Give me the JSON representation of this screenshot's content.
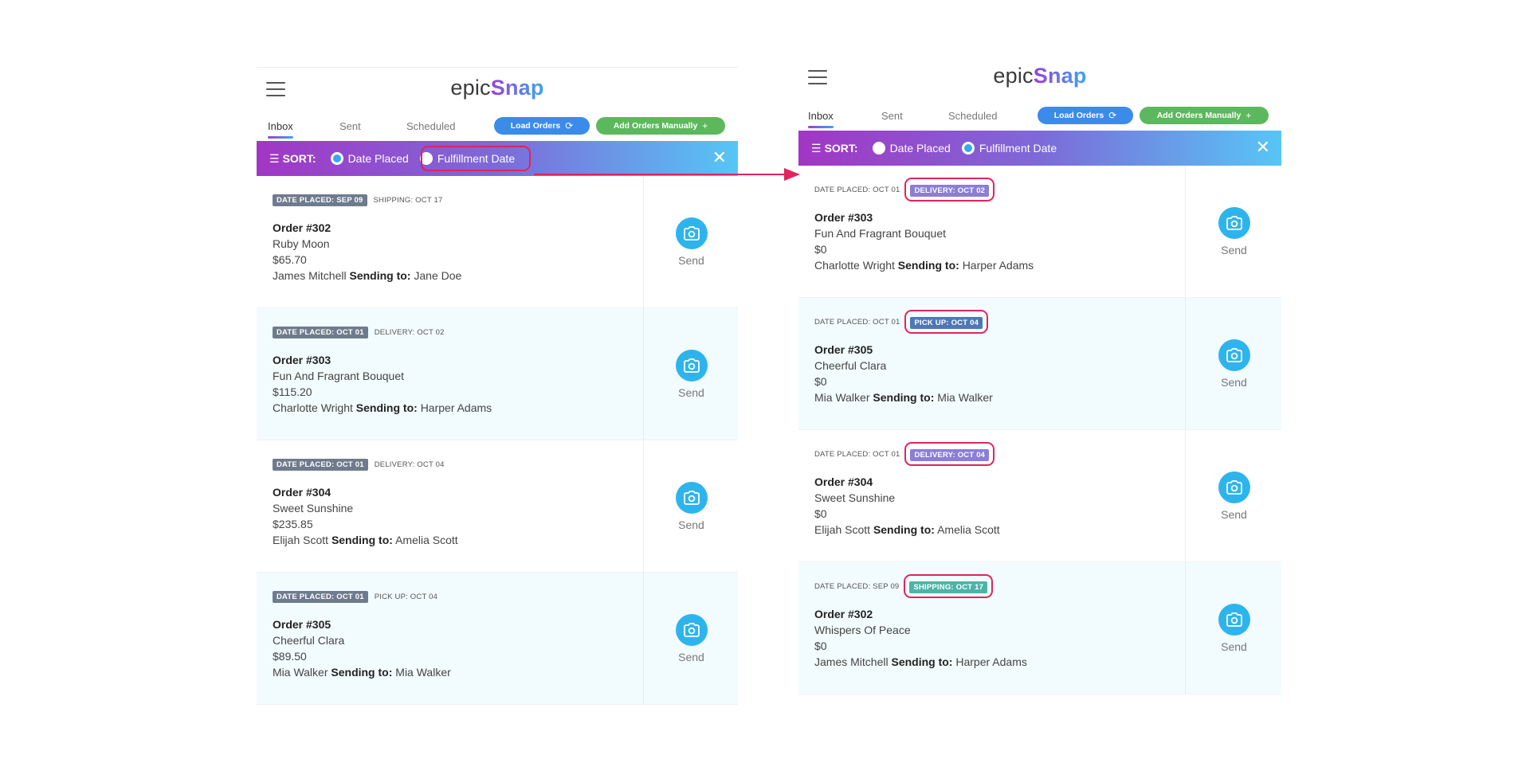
{
  "app": {
    "logo_epic": "epic",
    "logo_snap": "Snap"
  },
  "tabs": [
    {
      "label": "Inbox"
    },
    {
      "label": "Sent"
    },
    {
      "label": "Scheduled"
    }
  ],
  "buttons": {
    "load_orders": "Load Orders",
    "add_orders": "Add Orders Manually"
  },
  "sort": {
    "label": "SORT:",
    "option_date_placed": "Date Placed",
    "option_fulfillment": "Fulfillment Date"
  },
  "send_label": "Send",
  "sending_to_label": "Sending to:",
  "left_panel": {
    "selected_sort": "Date Placed",
    "orders": [
      {
        "date_placed": "DATE PLACED: SEP 09",
        "fulfillment": "SHIPPING: OCT 17",
        "number": "Order #302",
        "product": "Ruby Moon",
        "price": "$65.70",
        "sender": "James Mitchell",
        "recipient": "Jane Doe"
      },
      {
        "date_placed": "DATE PLACED: OCT 01",
        "fulfillment": "DELIVERY: OCT 02",
        "number": "Order #303",
        "product": "Fun And Fragrant Bouquet",
        "price": "$115.20",
        "sender": "Charlotte Wright",
        "recipient": "Harper Adams"
      },
      {
        "date_placed": "DATE PLACED: OCT 01",
        "fulfillment": "DELIVERY: OCT 04",
        "number": "Order #304",
        "product": "Sweet Sunshine",
        "price": "$235.85",
        "sender": "Elijah Scott",
        "recipient": "Amelia Scott"
      },
      {
        "date_placed": "DATE PLACED: OCT 01",
        "fulfillment": "PICK UP: OCT 04",
        "number": "Order #305",
        "product": "Cheerful Clara",
        "price": "$89.50",
        "sender": "Mia Walker",
        "recipient": "Mia Walker"
      }
    ]
  },
  "right_panel": {
    "selected_sort": "Fulfillment Date",
    "orders": [
      {
        "date_placed": "DATE PLACED: OCT 01",
        "fulfillment": "DELIVERY: OCT 02",
        "tag_color": "#8b7dd8",
        "number": "Order #303",
        "product": "Fun And Fragrant Bouquet",
        "price": "$0",
        "sender": "Charlotte Wright",
        "recipient": "Harper Adams"
      },
      {
        "date_placed": "DATE PLACED: OCT 01",
        "fulfillment": "PICK UP: OCT 04",
        "tag_color": "#4f77b4",
        "number": "Order #305",
        "product": "Cheerful Clara",
        "price": "$0",
        "sender": "Mia Walker",
        "recipient": "Mia Walker"
      },
      {
        "date_placed": "DATE PLACED: OCT 01",
        "fulfillment": "DELIVERY: OCT 04",
        "tag_color": "#8b7dd8",
        "number": "Order #304",
        "product": "Sweet Sunshine",
        "price": "$0",
        "sender": "Elijah Scott",
        "recipient": "Amelia Scott"
      },
      {
        "date_placed": "DATE PLACED: SEP 09",
        "fulfillment": "SHIPPING: OCT 17",
        "tag_color": "#4db3a8",
        "number": "Order #302",
        "product": "Whispers Of Peace",
        "price": "$0",
        "sender": "James Mitchell",
        "recipient": "Harper Adams"
      }
    ]
  },
  "colors": {
    "accent_purple": "#9b3fd8",
    "accent_blue": "#3aa7f0",
    "highlight": "#e0245e",
    "load_button": "#3b8beb",
    "add_button": "#5cb85c",
    "camera": "#2eb4ec"
  }
}
